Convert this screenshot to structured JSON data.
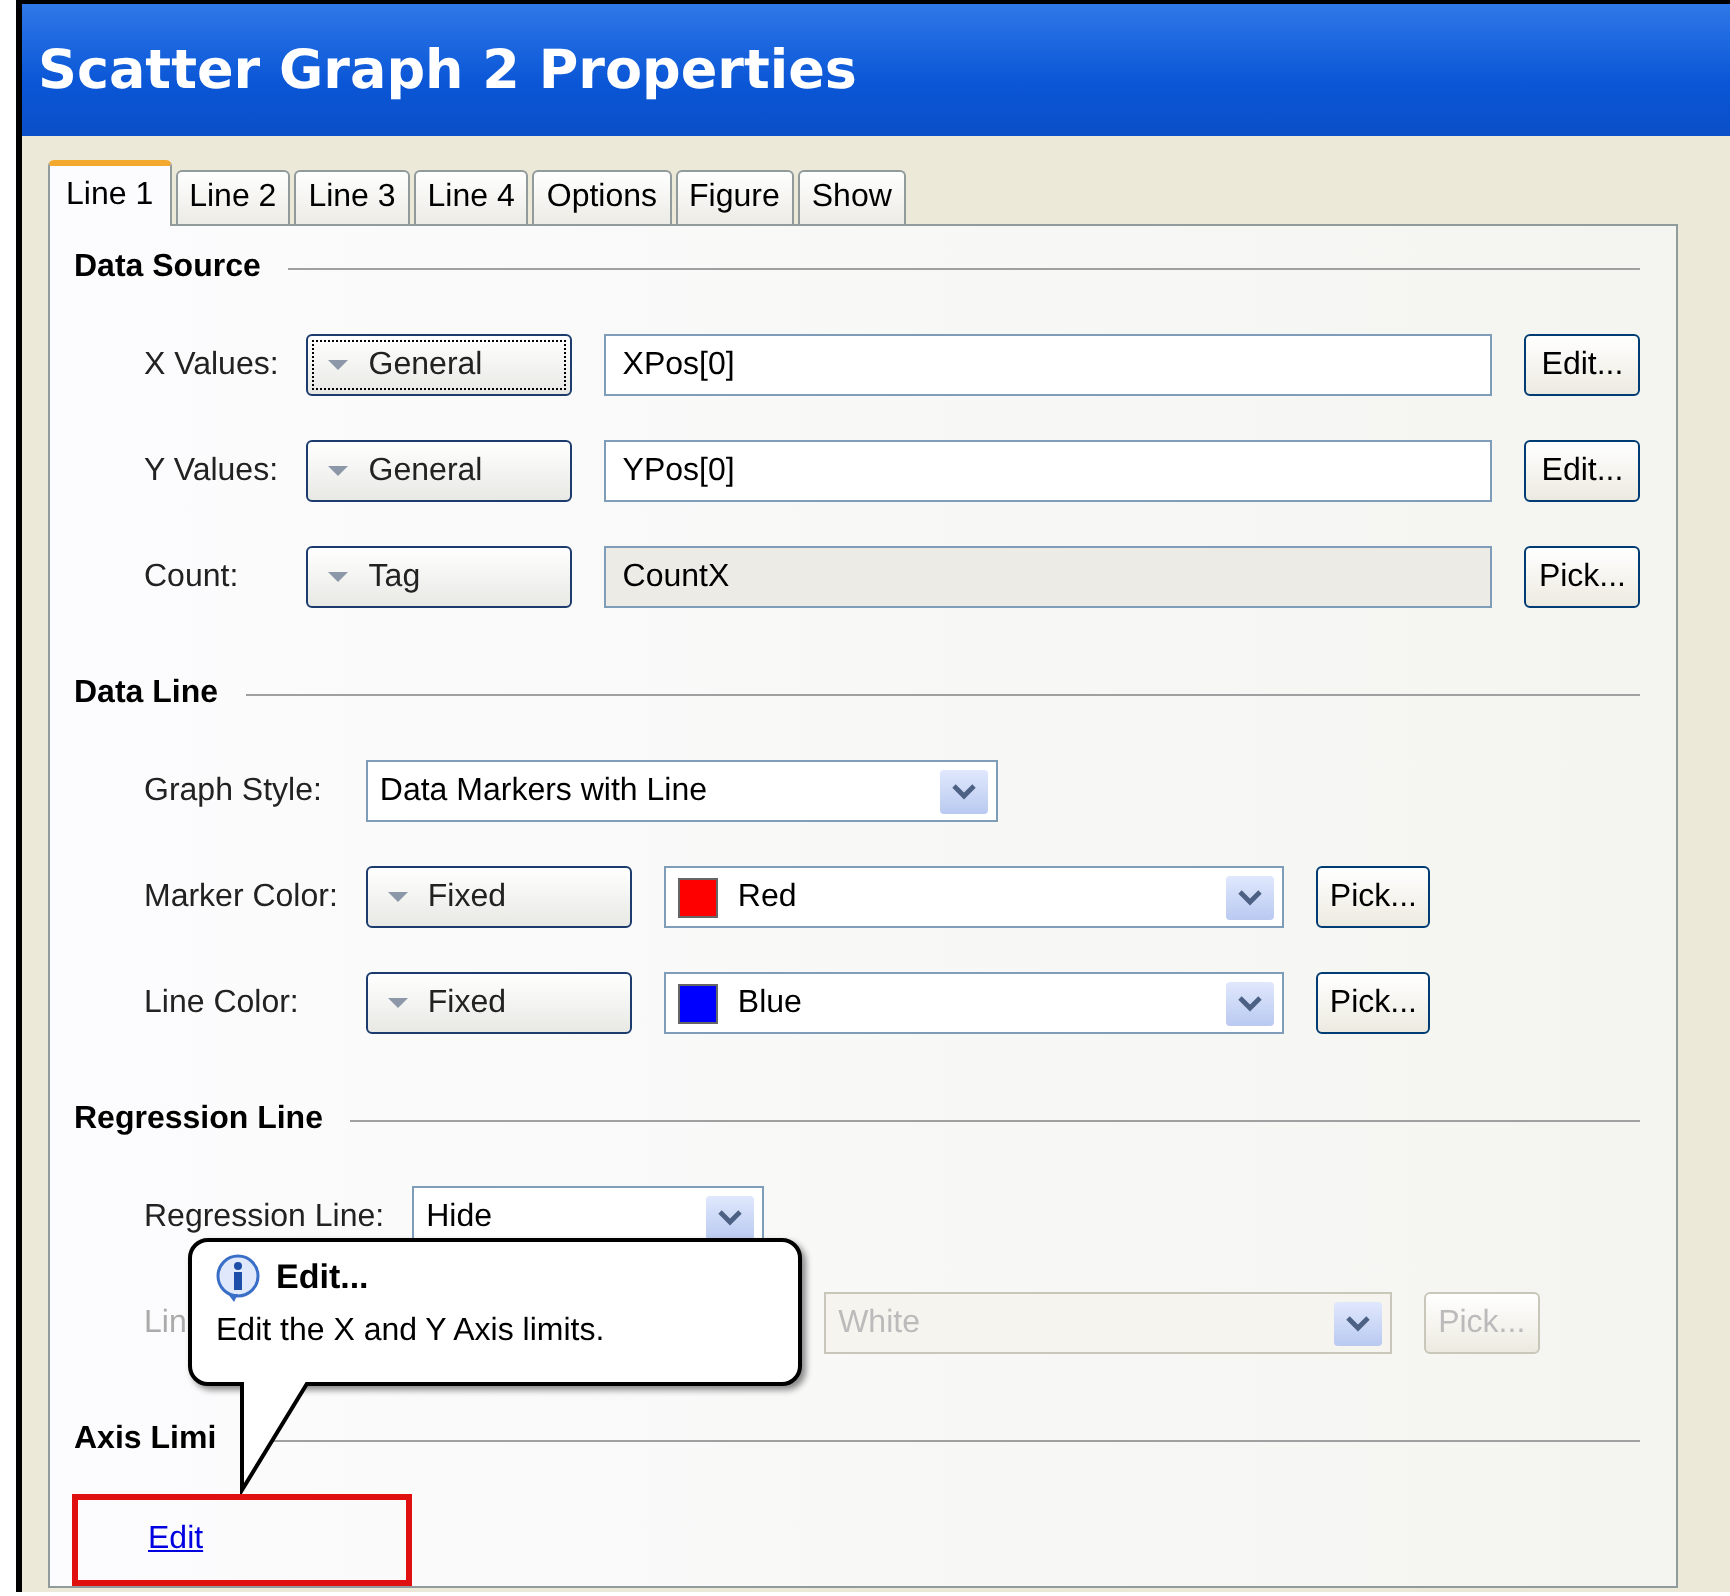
{
  "window": {
    "title": "Scatter Graph 2 Properties"
  },
  "tabs": [
    {
      "label": "Line 1",
      "selected": true
    },
    {
      "label": "Line 2",
      "selected": false
    },
    {
      "label": "Line 3",
      "selected": false
    },
    {
      "label": "Line 4",
      "selected": false
    },
    {
      "label": "Options",
      "selected": false
    },
    {
      "label": "Figure",
      "selected": false
    },
    {
      "label": "Show",
      "selected": false
    }
  ],
  "sections": [
    {
      "title": "Data Source",
      "rows": [
        {
          "kind": "source",
          "label": "X Values:",
          "mode": "General",
          "focused": true,
          "value": "XPos[0]",
          "readonly": false,
          "button": "Edit..."
        },
        {
          "kind": "source",
          "label": "Y Values:",
          "mode": "General",
          "focused": false,
          "value": "YPos[0]",
          "readonly": false,
          "button": "Edit..."
        },
        {
          "kind": "source",
          "label": "Count:",
          "mode": "Tag",
          "focused": false,
          "value": "CountX",
          "readonly": true,
          "button": "Pick..."
        }
      ]
    },
    {
      "title": "Data Line",
      "rows": [
        {
          "kind": "dropdown",
          "label": "Graph Style:",
          "value": "Data Markers with Line"
        },
        {
          "kind": "color",
          "label": "Marker Color:",
          "mode": "Fixed",
          "color": "#ff0000",
          "color_name": "Red",
          "button": "Pick...",
          "disabled": false
        },
        {
          "kind": "color",
          "label": "Line Color:",
          "mode": "Fixed",
          "color": "#0000ff",
          "color_name": "Blue",
          "button": "Pick...",
          "disabled": false
        }
      ]
    },
    {
      "title": "Regression Line",
      "rows": [
        {
          "kind": "dropdown",
          "label": "Regression Line:",
          "value": "Hide"
        },
        {
          "kind": "color",
          "label": "Lin",
          "color_name": "White",
          "button": "Pick...",
          "disabled": true
        }
      ]
    },
    {
      "title": "Axis Limi",
      "rows": [
        {
          "kind": "link",
          "value": "Edit",
          "highlighted": true
        }
      ]
    }
  ],
  "tooltip": {
    "title": "Edit...",
    "text": "Edit the X and Y Axis limits."
  }
}
